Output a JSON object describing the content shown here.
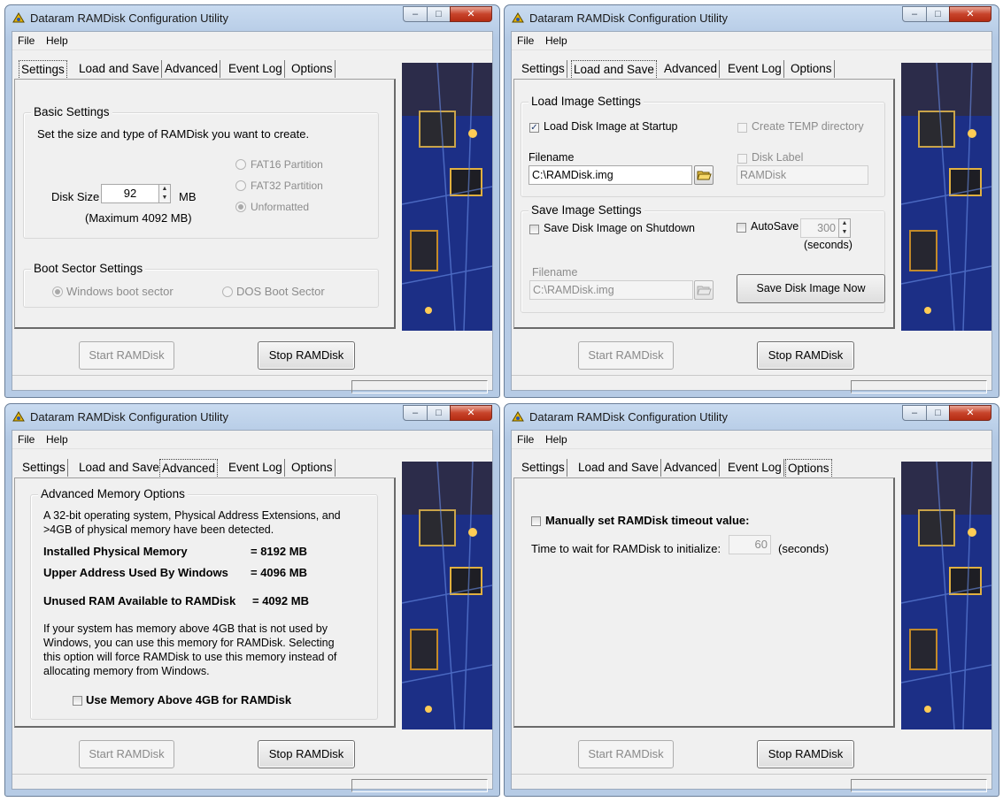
{
  "app": {
    "title": "Dataram RAMDisk Configuration Utility",
    "menu": {
      "file": "File",
      "help": "Help"
    },
    "tabs": [
      "Settings",
      "Load and Save",
      "Advanced",
      "Event Log",
      "Options"
    ],
    "buttons": {
      "start": "Start RAMDisk",
      "stop": "Stop RAMDisk"
    },
    "window_controls": {
      "minimize": "–",
      "maximize": "□",
      "close": "✕"
    }
  },
  "settings": {
    "basic_title": "Basic Settings",
    "intro": "Set the size and type of RAMDisk you want to create.",
    "disk_size_label": "Disk Size",
    "disk_size_value": "92",
    "disk_size_unit": "MB",
    "maximum": "(Maximum  4092 MB)",
    "partitions": [
      "FAT16 Partition",
      "FAT32 Partition",
      "Unformatted"
    ],
    "selected_partition": "Unformatted",
    "boot_title": "Boot Sector Settings",
    "boot_options": [
      "Windows boot sector",
      "DOS Boot Sector"
    ],
    "selected_boot": "Windows boot sector"
  },
  "load_save": {
    "load_title": "Load Image Settings",
    "load_at_startup": {
      "label": "Load Disk Image at Startup",
      "checked": true
    },
    "create_temp": {
      "label": "Create TEMP directory",
      "checked": false
    },
    "filename_label": "Filename",
    "load_filename": "C:\\RAMDisk.img",
    "disk_label_label": "Disk Label",
    "disk_label_value": "RAMDisk",
    "save_title": "Save Image Settings",
    "save_on_shutdown": {
      "label": "Save Disk Image on Shutdown",
      "checked": false
    },
    "autosave": {
      "label": "AutoSave",
      "checked": false,
      "value": "300",
      "unit": "(seconds)"
    },
    "save_filename_label": "Filename",
    "save_filename": "C:\\RAMDisk.img",
    "save_now_button": "Save Disk Image Now"
  },
  "advanced": {
    "title": "Advanced Memory Options",
    "intro_1": "A 32-bit operating system, Physical Address Extensions, and",
    "intro_2": ">4GB of physical memory have been detected.",
    "installed_label": "Installed Physical Memory",
    "installed_value": "= 8192 MB",
    "upper_label": "Upper Address Used By Windows",
    "upper_value": "= 4096 MB",
    "unused_label": "Unused RAM Available to RAMDisk",
    "unused_value": "= 4092 MB",
    "desc_1": "If your system has memory above 4GB that is not used by",
    "desc_2": "Windows, you can use this memory for RAMDisk. Selecting",
    "desc_3": "this option will force RAMDisk to use this memory instead of",
    "desc_4": "allocating memory from Windows.",
    "use_above_4gb": {
      "label": "Use Memory Above 4GB for RAMDisk",
      "checked": false
    }
  },
  "options": {
    "manual_timeout": {
      "label": "Manually set RAMDisk timeout value:",
      "checked": false
    },
    "wait_label": "Time to wait for RAMDisk to initialize:",
    "wait_value": "60",
    "wait_unit": "(seconds)"
  },
  "colors": {
    "title_bar": "#c4d6ee",
    "close_button": "#c7432a",
    "dialog_bg": "#f0f0f0",
    "photo_circuit": "#1c2f86"
  }
}
